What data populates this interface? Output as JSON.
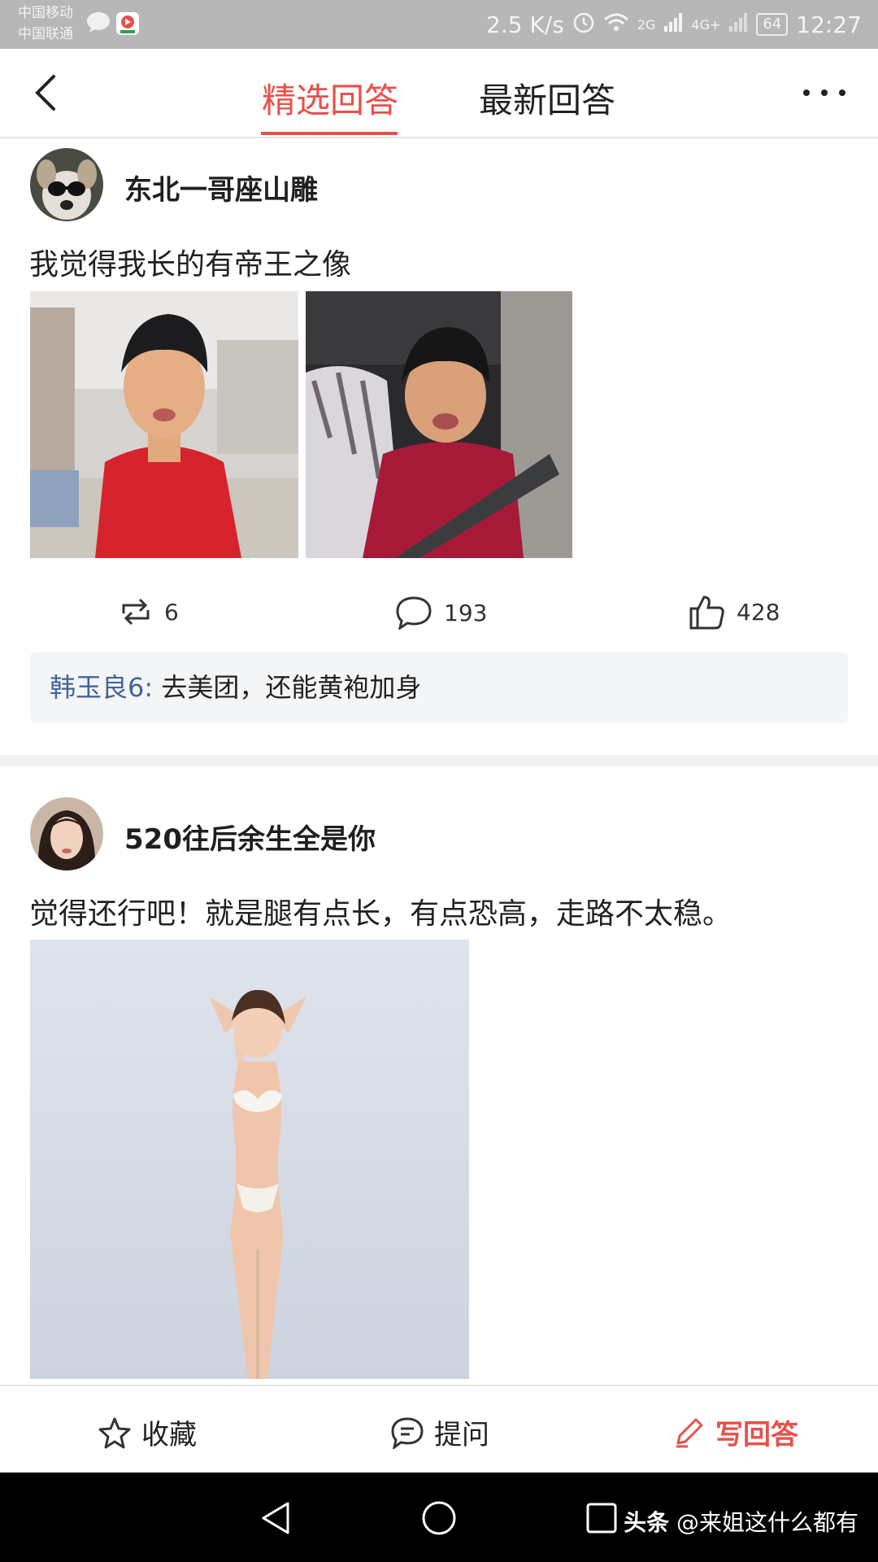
{
  "status_bar": {
    "carrier_1": "中国移动",
    "carrier_2": "中国联通",
    "speed": "2.5 K/s",
    "network_1": "2G",
    "network_2": "4G+",
    "battery": "64",
    "time": "12:27"
  },
  "header": {
    "tabs": [
      {
        "label": "精选回答",
        "active": true
      },
      {
        "label": "最新回答",
        "active": false
      }
    ]
  },
  "answers": [
    {
      "username": "东北一哥座山雕",
      "text": "我觉得我长的有帝王之像",
      "stats": {
        "reposts": "6",
        "comments": "193",
        "likes": "428"
      },
      "top_comment": {
        "author": "韩玉良6:",
        "text": " 去美团，还能黄袍加身"
      }
    },
    {
      "username": "520往后余生全是你",
      "text": "觉得还行吧！就是腿有点长，有点恐高，走路不太稳。"
    }
  ],
  "action_bar": {
    "favorite": "收藏",
    "ask": "提问",
    "write": "写回答"
  },
  "watermark": {
    "brand": "头条",
    "handle": " @来姐这什么都有"
  },
  "colors": {
    "accent": "#e8504a",
    "comment_author": "#406599",
    "status_bar": "#b7b7b7",
    "nav_bar": "#000000"
  }
}
